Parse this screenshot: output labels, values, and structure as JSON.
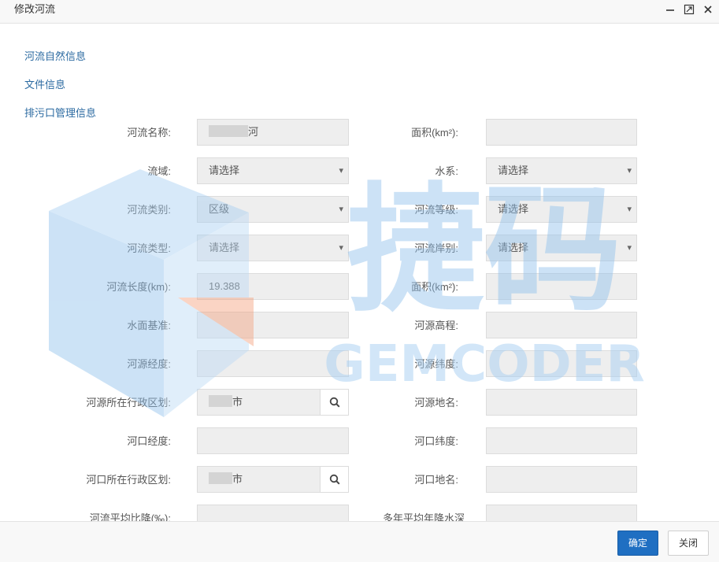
{
  "window": {
    "title": "修改河流"
  },
  "sidebar": {
    "items": [
      {
        "label": "河流自然信息"
      },
      {
        "label": "文件信息"
      },
      {
        "label": "排污口管理信息"
      }
    ]
  },
  "form": {
    "river_name": {
      "label": "河流名称:",
      "value_suffix": "河"
    },
    "area1": {
      "label": "面积(km²):",
      "value": ""
    },
    "basin": {
      "label": "流域:",
      "value": "请选择"
    },
    "water_system": {
      "label": "水系:",
      "value": "请选择"
    },
    "river_category": {
      "label": "河流类别:",
      "value": "区级"
    },
    "river_grade": {
      "label": "河流等级:",
      "value": "请选择"
    },
    "river_type": {
      "label": "河流类型:",
      "value": "请选择"
    },
    "bank_type": {
      "label": "河流岸别:",
      "value": "请选择"
    },
    "river_length": {
      "label": "河流长度(km):",
      "value": "19.388"
    },
    "area2": {
      "label": "面积(km²):",
      "value": ""
    },
    "water_datum": {
      "label": "水面基准:",
      "value": ""
    },
    "source_elevation": {
      "label": "河源高程:",
      "value": ""
    },
    "source_lon": {
      "label": "河源经度:",
      "value": ""
    },
    "source_lat": {
      "label": "河源纬度:",
      "value": ""
    },
    "source_region": {
      "label": "河源所在行政区划:",
      "value_suffix": "市"
    },
    "source_place": {
      "label": "河源地名:",
      "value": ""
    },
    "mouth_lon": {
      "label": "河口经度:",
      "value": ""
    },
    "mouth_lat": {
      "label": "河口纬度:",
      "value": ""
    },
    "mouth_region": {
      "label": "河口所在行政区划:",
      "value_suffix": "市"
    },
    "mouth_place": {
      "label": "河口地名:",
      "value": ""
    },
    "avg_slope": {
      "label": "河流平均比降(‰):",
      "value": ""
    },
    "avg_rainfall": {
      "label": "多年平均年降水深",
      "value": ""
    }
  },
  "footer": {
    "ok_label": "确定",
    "close_label": "关闭"
  },
  "watermark": {
    "text_cn": "捷码",
    "text_en": "GEMCODER"
  },
  "colors": {
    "link": "#2b6aa1",
    "primary": "#1f6fc2",
    "input_bg": "#eeeeee",
    "watermark_blue": "#8fc0ec",
    "watermark_orange": "#f4a27e"
  },
  "icons": {
    "search": "search-icon",
    "minimize": "minimize-icon",
    "maximize": "maximize-icon",
    "close": "close-icon",
    "dropdown": "chevron-down-icon"
  }
}
